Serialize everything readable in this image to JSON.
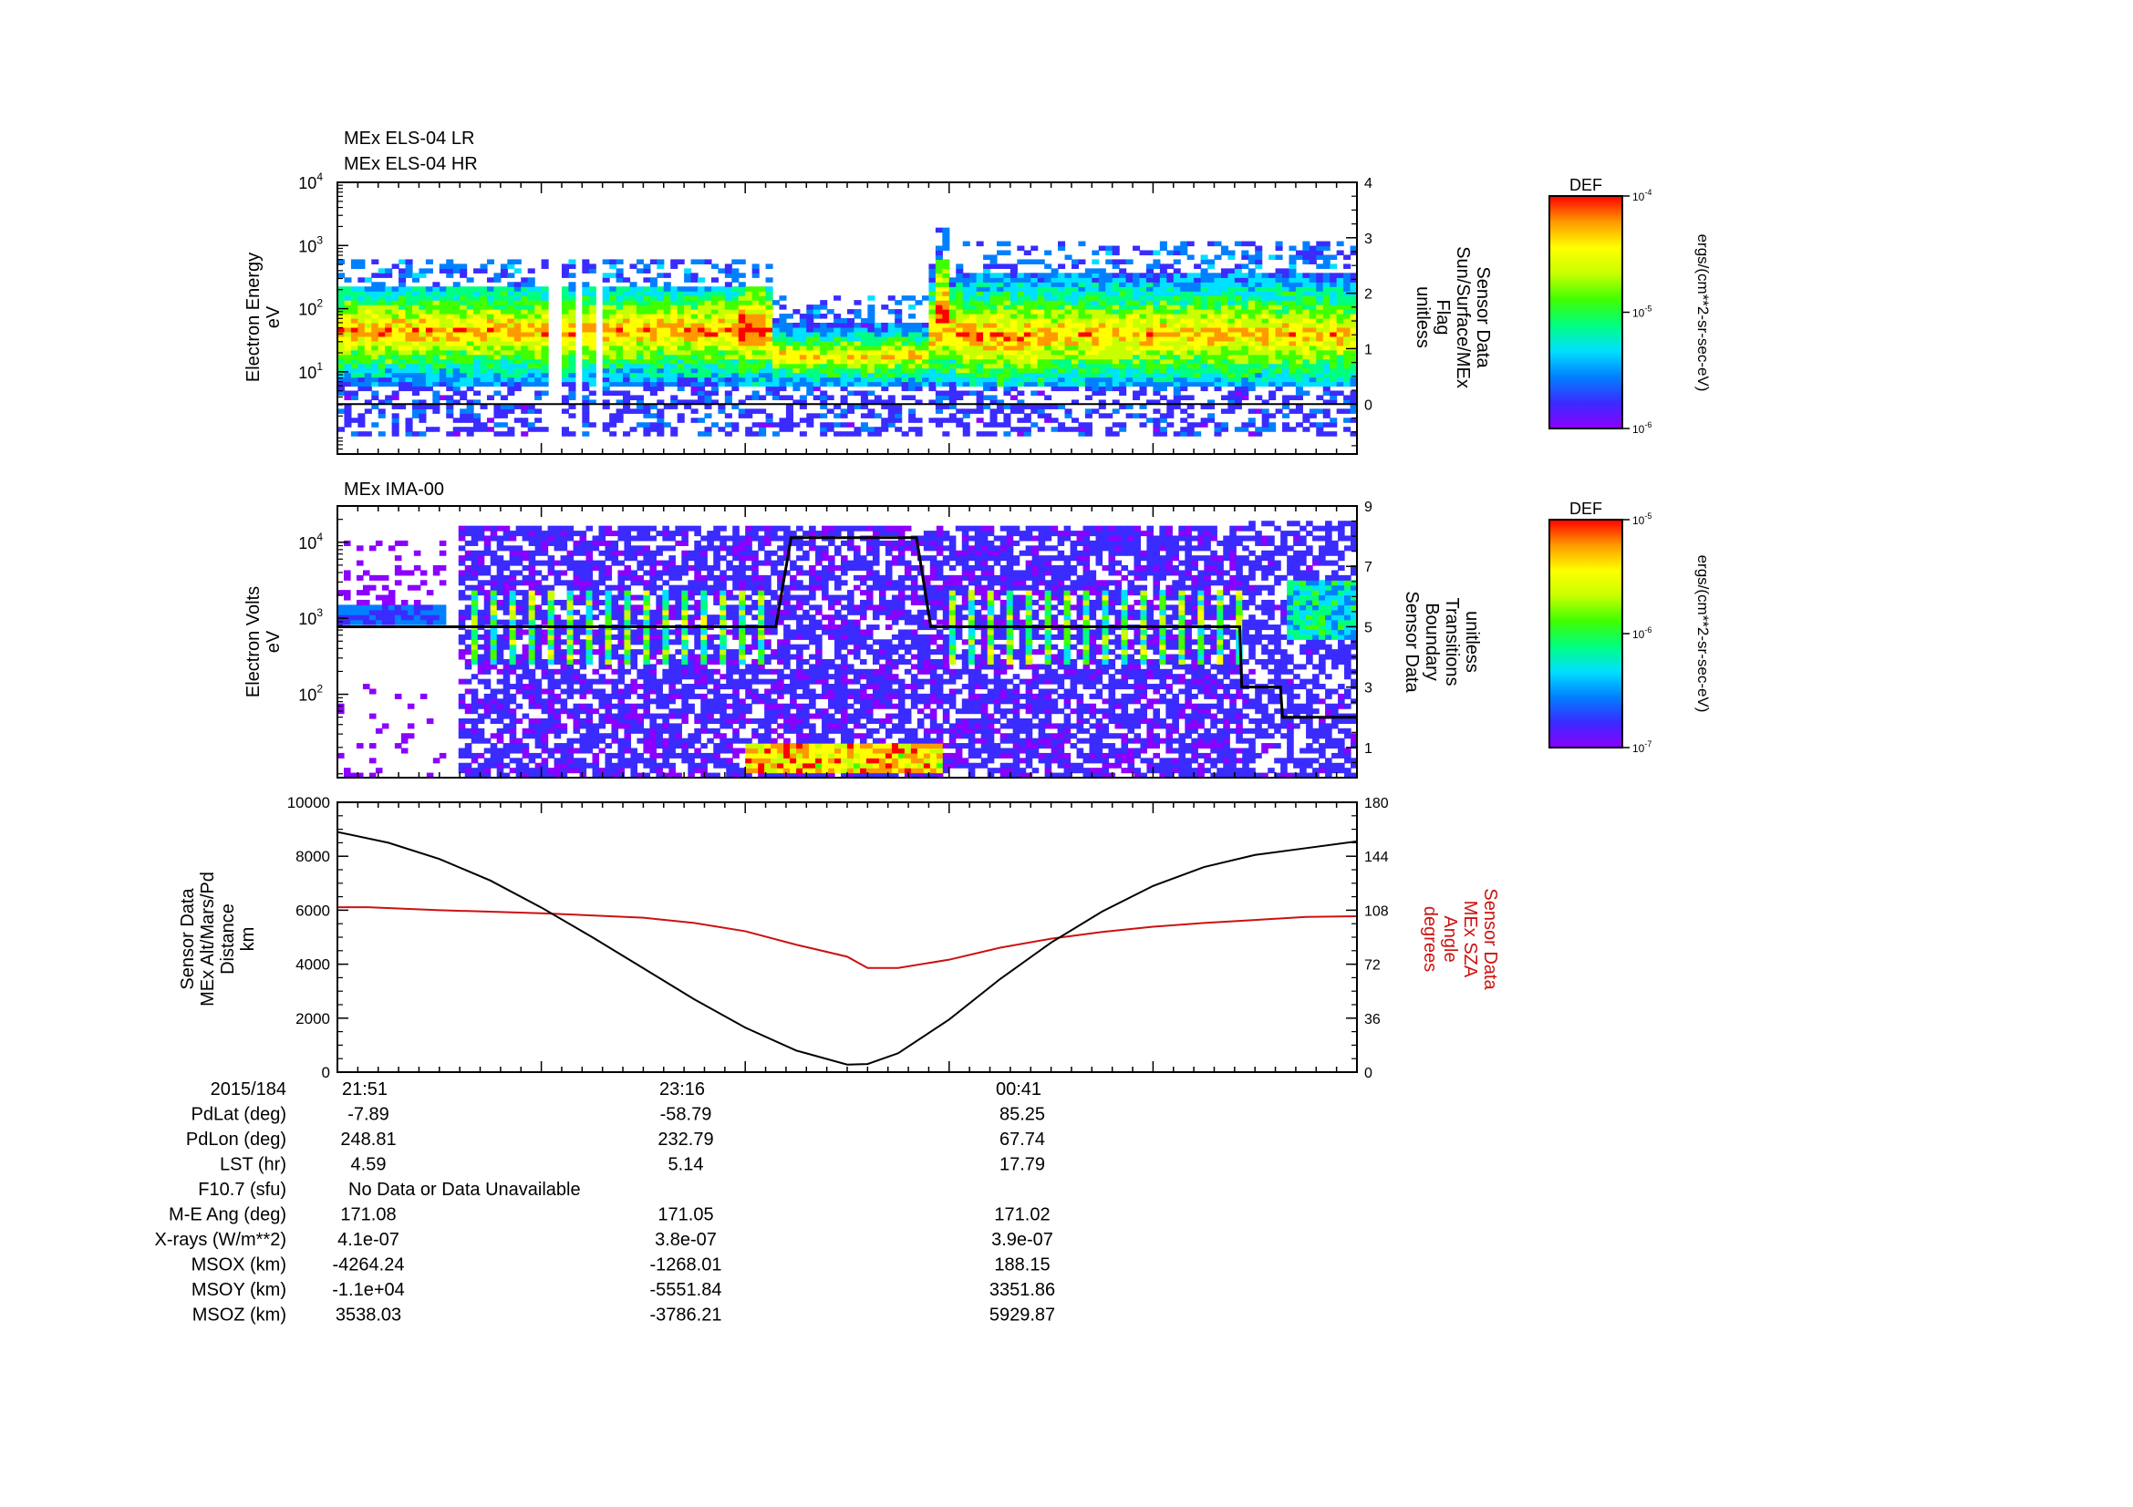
{
  "colors": {
    "background": "#ffffff",
    "axis": "#000000",
    "distance_line": "#000000",
    "sza_line": "#cc1111",
    "flag_line": "#000000",
    "boundary_line": "#000000",
    "sza_label": "#cc1111",
    "colormap": [
      "#8b00ff",
      "#3a2bff",
      "#0080ff",
      "#00e0ff",
      "#00ff80",
      "#40ff00",
      "#c8ff00",
      "#ffff00",
      "#ff9900",
      "#ff0000"
    ]
  },
  "chart_data": [
    {
      "type": "heatmap",
      "titles": [
        "MEx ELS-04 LR",
        "MEx ELS-04 HR"
      ],
      "ylabel": [
        "Electron Energy",
        "eV"
      ],
      "ylabel_right": [
        "Sensor Data",
        "Sun/Surface/MEx",
        "Flag",
        "unitless"
      ],
      "y_scale": "log",
      "ylim": [
        0.5,
        10000
      ],
      "y_ticks": [
        {
          "v": 10,
          "base": "10",
          "exp": "1"
        },
        {
          "v": 100,
          "base": "10",
          "exp": "2"
        },
        {
          "v": 1000,
          "base": "10",
          "exp": "3"
        },
        {
          "v": 10000,
          "base": "10",
          "exp": "4"
        }
      ],
      "y2lim": [
        -0.9,
        4
      ],
      "y2_ticks": [
        "0",
        "1",
        "2",
        "3",
        "4"
      ],
      "grid": false,
      "colorbar": {
        "title": "DEF",
        "unit": "ergs/(cm**2-sr-sec-eV)",
        "ticks": [
          {
            "base": "10",
            "exp": "-4"
          },
          {
            "base": "10",
            "exp": "-5"
          },
          {
            "base": "10",
            "exp": "-6"
          }
        ]
      },
      "flag_line": {
        "x": [
          0,
          1
        ],
        "y": [
          0,
          0
        ]
      }
    },
    {
      "type": "heatmap",
      "titles": [
        "MEx IMA-00"
      ],
      "ylabel": [
        "Electron Volts",
        "eV"
      ],
      "ylabel_right": [
        "Sensor Data",
        "Boundary",
        "Transitions",
        "unitless"
      ],
      "y_scale": "log",
      "ylim": [
        8,
        30000
      ],
      "y_ticks": [
        {
          "v": 100,
          "base": "10",
          "exp": "2"
        },
        {
          "v": 1000,
          "base": "10",
          "exp": "3"
        },
        {
          "v": 10000,
          "base": "10",
          "exp": "4"
        }
      ],
      "y2lim": [
        0,
        9
      ],
      "y2_ticks": [
        "1",
        "3",
        "5",
        "7",
        "9"
      ],
      "grid": false,
      "colorbar": {
        "title": "DEF",
        "unit": "ergs/(cm**2-sr-sec-eV)",
        "ticks": [
          {
            "base": "10",
            "exp": "-5"
          },
          {
            "base": "10",
            "exp": "-6"
          },
          {
            "base": "10",
            "exp": "-7"
          }
        ]
      },
      "boundary_line": {
        "x": [
          0.0,
          0.43,
          0.445,
          0.568,
          0.582,
          0.885,
          0.887,
          0.925,
          0.927,
          1.0
        ],
        "y": [
          5.0,
          5.0,
          7.95,
          7.95,
          5.0,
          5.0,
          3.0,
          3.0,
          2.0,
          2.0
        ]
      }
    },
    {
      "type": "line",
      "ylabel": [
        "Sensor Data",
        "MEx Alt/Mars/Pd",
        "Distance",
        "km"
      ],
      "ylabel_right": [
        "Sensor Data",
        "MEx SZA",
        "Angle",
        "degrees"
      ],
      "ylim": [
        0,
        10000
      ],
      "y_ticks": [
        "0",
        "2000",
        "4000",
        "6000",
        "8000",
        "10000"
      ],
      "y2lim": [
        0,
        180
      ],
      "y2_ticks": [
        "0",
        "36",
        "72",
        "108",
        "144",
        "180"
      ],
      "grid": false,
      "series": [
        {
          "axis": "left",
          "x": [
            0.0,
            0.05,
            0.1,
            0.15,
            0.2,
            0.25,
            0.3,
            0.35,
            0.4,
            0.45,
            0.5,
            0.52,
            0.55,
            0.6,
            0.65,
            0.7,
            0.75,
            0.8,
            0.85,
            0.9,
            0.95,
            1.0
          ],
          "y": [
            8900,
            8500,
            7900,
            7100,
            6100,
            5000,
            3850,
            2700,
            1650,
            800,
            280,
            300,
            700,
            1950,
            3450,
            4800,
            5950,
            6900,
            7600,
            8050,
            8300,
            8550
          ]
        },
        {
          "axis": "right",
          "x": [
            0.0,
            0.03,
            0.1,
            0.15,
            0.2,
            0.3,
            0.35,
            0.4,
            0.45,
            0.5,
            0.52,
            0.55,
            0.6,
            0.65,
            0.7,
            0.75,
            0.8,
            0.85,
            0.9,
            0.95,
            1.0
          ],
          "y": [
            110,
            110,
            108,
            107,
            106,
            103,
            99.5,
            94,
            85,
            77,
            69.5,
            69.5,
            75,
            83,
            89,
            93.5,
            97,
            99.5,
            101.5,
            103.5,
            104
          ]
        }
      ]
    }
  ],
  "ephemeris": {
    "rows": [
      {
        "label": "2015/184",
        "values": [
          "21:51",
          "23:16",
          "00:41"
        ]
      },
      {
        "label": "PdLat (deg)",
        "values": [
          "-7.89",
          "-58.79",
          "85.25"
        ]
      },
      {
        "label": "PdLon (deg)",
        "values": [
          "248.81",
          "232.79",
          "67.74"
        ]
      },
      {
        "label": "LST (hr)",
        "values": [
          "4.59",
          "5.14",
          "17.79"
        ]
      },
      {
        "label": "F10.7 (sfu)",
        "values": [
          "No Data or Data Unavailable"
        ]
      },
      {
        "label": "M-E Ang (deg)",
        "values": [
          "171.08",
          "171.05",
          "171.02"
        ]
      },
      {
        "label": "X-rays (W/m**2)",
        "values": [
          "4.1e-07",
          "3.8e-07",
          "3.9e-07"
        ]
      },
      {
        "label": "MSOX (km)",
        "values": [
          "-4264.24",
          "-1268.01",
          "188.15"
        ]
      },
      {
        "label": "MSOY (km)",
        "values": [
          "-1.1e+04",
          "-5551.84",
          "3351.86"
        ]
      },
      {
        "label": "MSOZ (km)",
        "values": [
          "3538.03",
          "-3786.21",
          "5929.87"
        ]
      }
    ]
  }
}
